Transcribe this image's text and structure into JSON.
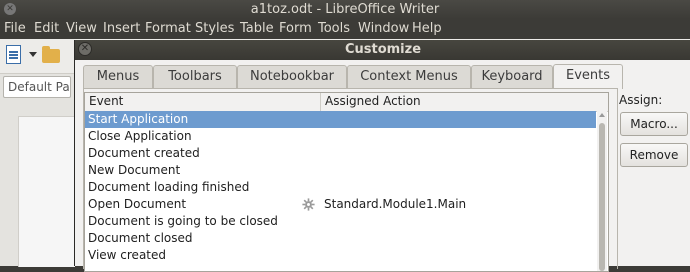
{
  "app": {
    "title": "a1toz.odt - LibreOffice Writer"
  },
  "menubar": [
    "File",
    "Edit",
    "View",
    "Insert",
    "Format",
    "Styles",
    "Table",
    "Form",
    "Tools",
    "Window",
    "Help"
  ],
  "toolbar": {
    "paragraph_style": "Default Paragraph Style"
  },
  "dialog": {
    "title": "Customize",
    "tabs": [
      "Menus",
      "Toolbars",
      "Notebookbar",
      "Context Menus",
      "Keyboard",
      "Events"
    ],
    "active_tab": "Events",
    "columns": {
      "event": "Event",
      "action": "Assigned Action"
    },
    "rows": [
      {
        "event": "Start Application",
        "action": "",
        "selected": true
      },
      {
        "event": "Close Application",
        "action": ""
      },
      {
        "event": "Document created",
        "action": ""
      },
      {
        "event": "New Document",
        "action": ""
      },
      {
        "event": "Document loading finished",
        "action": ""
      },
      {
        "event": "Open Document",
        "action": "Standard.Module1.Main",
        "icon": "gear-icon"
      },
      {
        "event": "Document is going to be closed",
        "action": ""
      },
      {
        "event": "Document closed",
        "action": ""
      },
      {
        "event": "View created",
        "action": ""
      }
    ],
    "assign_label": "Assign:",
    "macro_button": "Macro...",
    "remove_button": "Remove"
  },
  "colors": {
    "selection": "#6d9bcf",
    "titlebar": "#3c3b37"
  }
}
